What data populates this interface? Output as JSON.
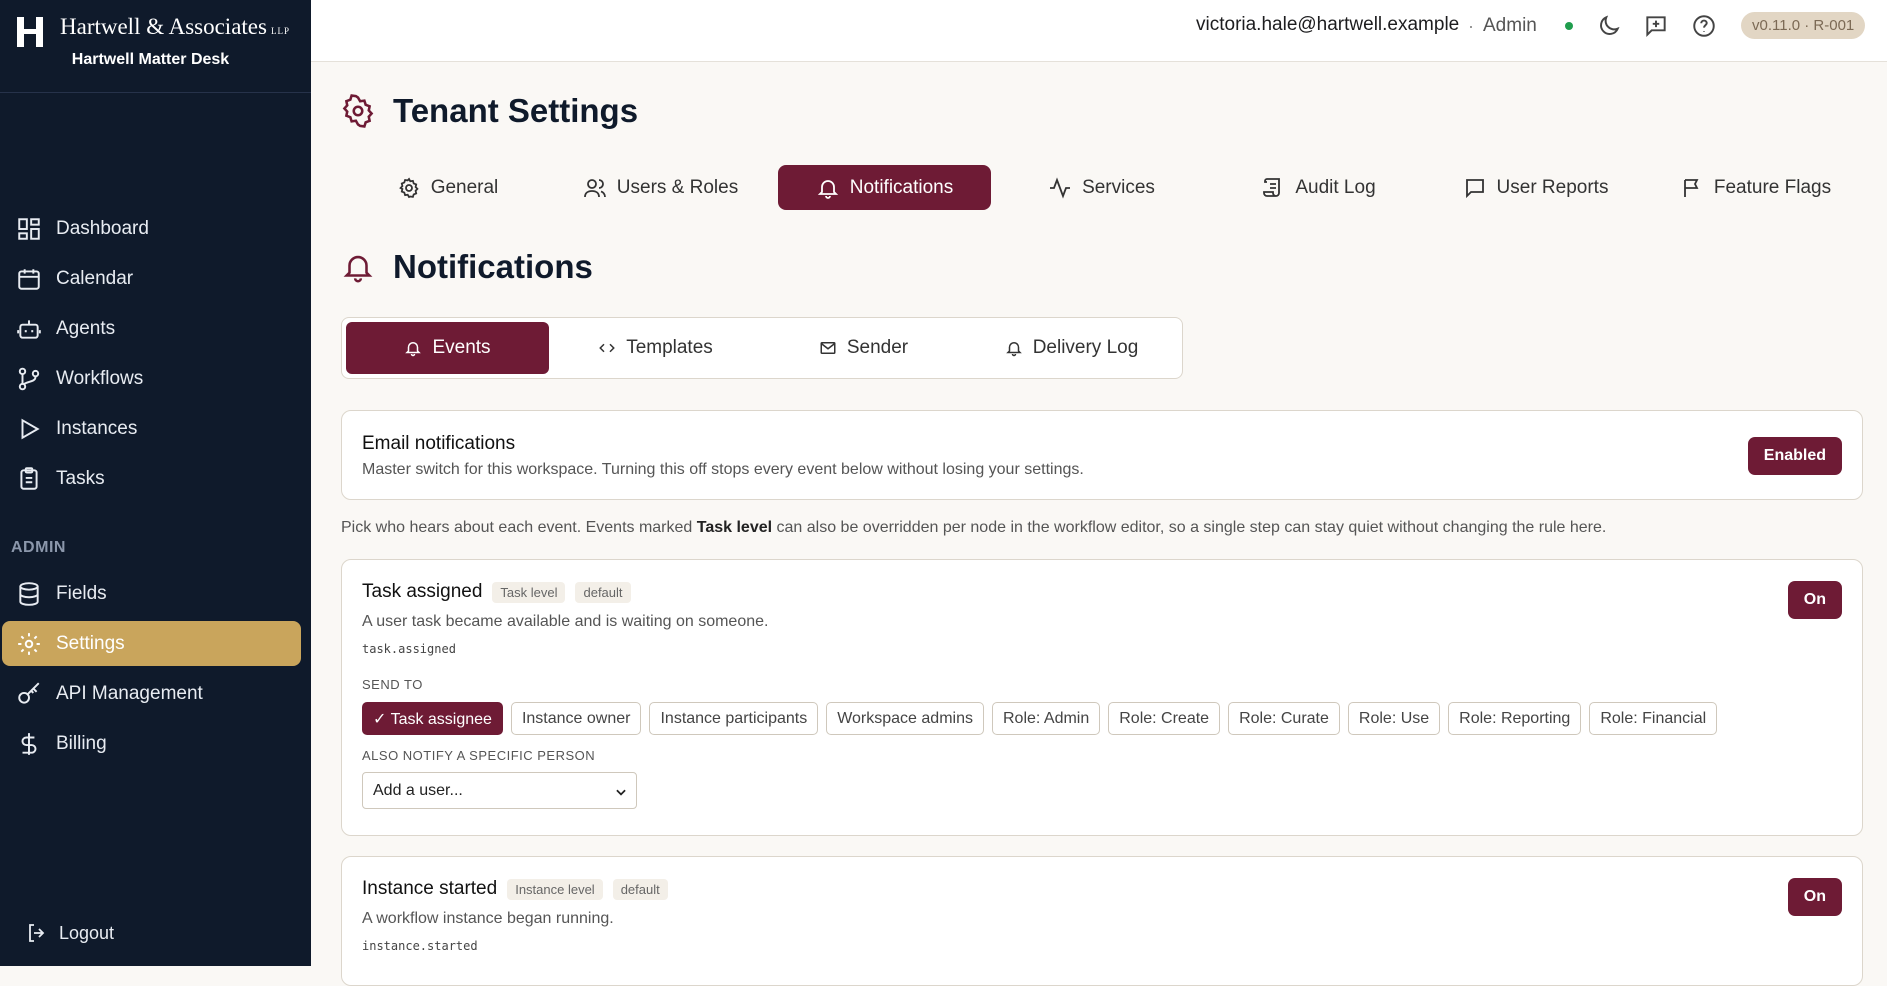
{
  "brand": {
    "name": "Hartwell & Associates",
    "suffix": "LLP",
    "subtitle": "Hartwell Matter Desk"
  },
  "sidebar": {
    "items": [
      {
        "label": "Dashboard",
        "icon": "dashboard-icon"
      },
      {
        "label": "Calendar",
        "icon": "calendar-icon"
      },
      {
        "label": "Agents",
        "icon": "robot-icon"
      },
      {
        "label": "Workflows",
        "icon": "git-branch-icon"
      },
      {
        "label": "Instances",
        "icon": "play-icon"
      },
      {
        "label": "Tasks",
        "icon": "clipboard-icon"
      }
    ],
    "admin_label": "ADMIN",
    "admin_items": [
      {
        "label": "Fields",
        "icon": "database-icon"
      },
      {
        "label": "Settings",
        "icon": "gear-icon",
        "active": true
      },
      {
        "label": "API Management",
        "icon": "key-icon"
      },
      {
        "label": "Billing",
        "icon": "dollar-icon"
      }
    ],
    "logout_label": "Logout"
  },
  "topbar": {
    "email": "victoria.hale@hartwell.example",
    "separator": "·",
    "role": "Admin",
    "version": "v0.11.0 · R-001"
  },
  "page": {
    "title": "Tenant Settings"
  },
  "tabs": [
    {
      "label": "General",
      "icon": "gear-icon"
    },
    {
      "label": "Users & Roles",
      "icon": "users-icon"
    },
    {
      "label": "Notifications",
      "icon": "bell-icon",
      "active": true
    },
    {
      "label": "Services",
      "icon": "activity-icon"
    },
    {
      "label": "Audit Log",
      "icon": "scroll-icon"
    },
    {
      "label": "User Reports",
      "icon": "message-icon"
    },
    {
      "label": "Feature Flags",
      "icon": "flag-icon"
    }
  ],
  "section": {
    "title": "Notifications"
  },
  "subtabs": [
    {
      "label": "Events",
      "icon": "bell-icon",
      "active": true
    },
    {
      "label": "Templates",
      "icon": "code-icon"
    },
    {
      "label": "Sender",
      "icon": "mail-icon"
    },
    {
      "label": "Delivery Log",
      "icon": "bell-icon"
    }
  ],
  "email_card": {
    "title": "Email notifications",
    "description": "Master switch for this workspace. Turning this off stops every event below without losing your settings.",
    "button": "Enabled"
  },
  "help": {
    "before": "Pick who hears about each event. Events marked ",
    "bold": "Task level",
    "after": " can also be overridden per node in the workflow editor, so a single step can stay quiet without changing the rule here."
  },
  "events": [
    {
      "name": "Task assigned",
      "level": "Task level",
      "tag": "default",
      "description": "A user task became available and is waiting on someone.",
      "code": "task.assigned",
      "toggle": "On",
      "send_to_label": "SEND TO",
      "recipients": [
        {
          "label": "✓ Task assignee",
          "active": true
        },
        {
          "label": "Instance owner"
        },
        {
          "label": "Instance participants"
        },
        {
          "label": "Workspace admins"
        },
        {
          "label": "Role: Admin"
        },
        {
          "label": "Role: Create"
        },
        {
          "label": "Role: Curate"
        },
        {
          "label": "Role: Use"
        },
        {
          "label": "Role: Reporting"
        },
        {
          "label": "Role: Financial"
        }
      ],
      "notify_label": "ALSO NOTIFY A SPECIFIC PERSON",
      "select_value": "Add a user..."
    },
    {
      "name": "Instance started",
      "level": "Instance level",
      "tag": "default",
      "description": "A workflow instance began running.",
      "code": "instance.started",
      "toggle": "On"
    }
  ]
}
